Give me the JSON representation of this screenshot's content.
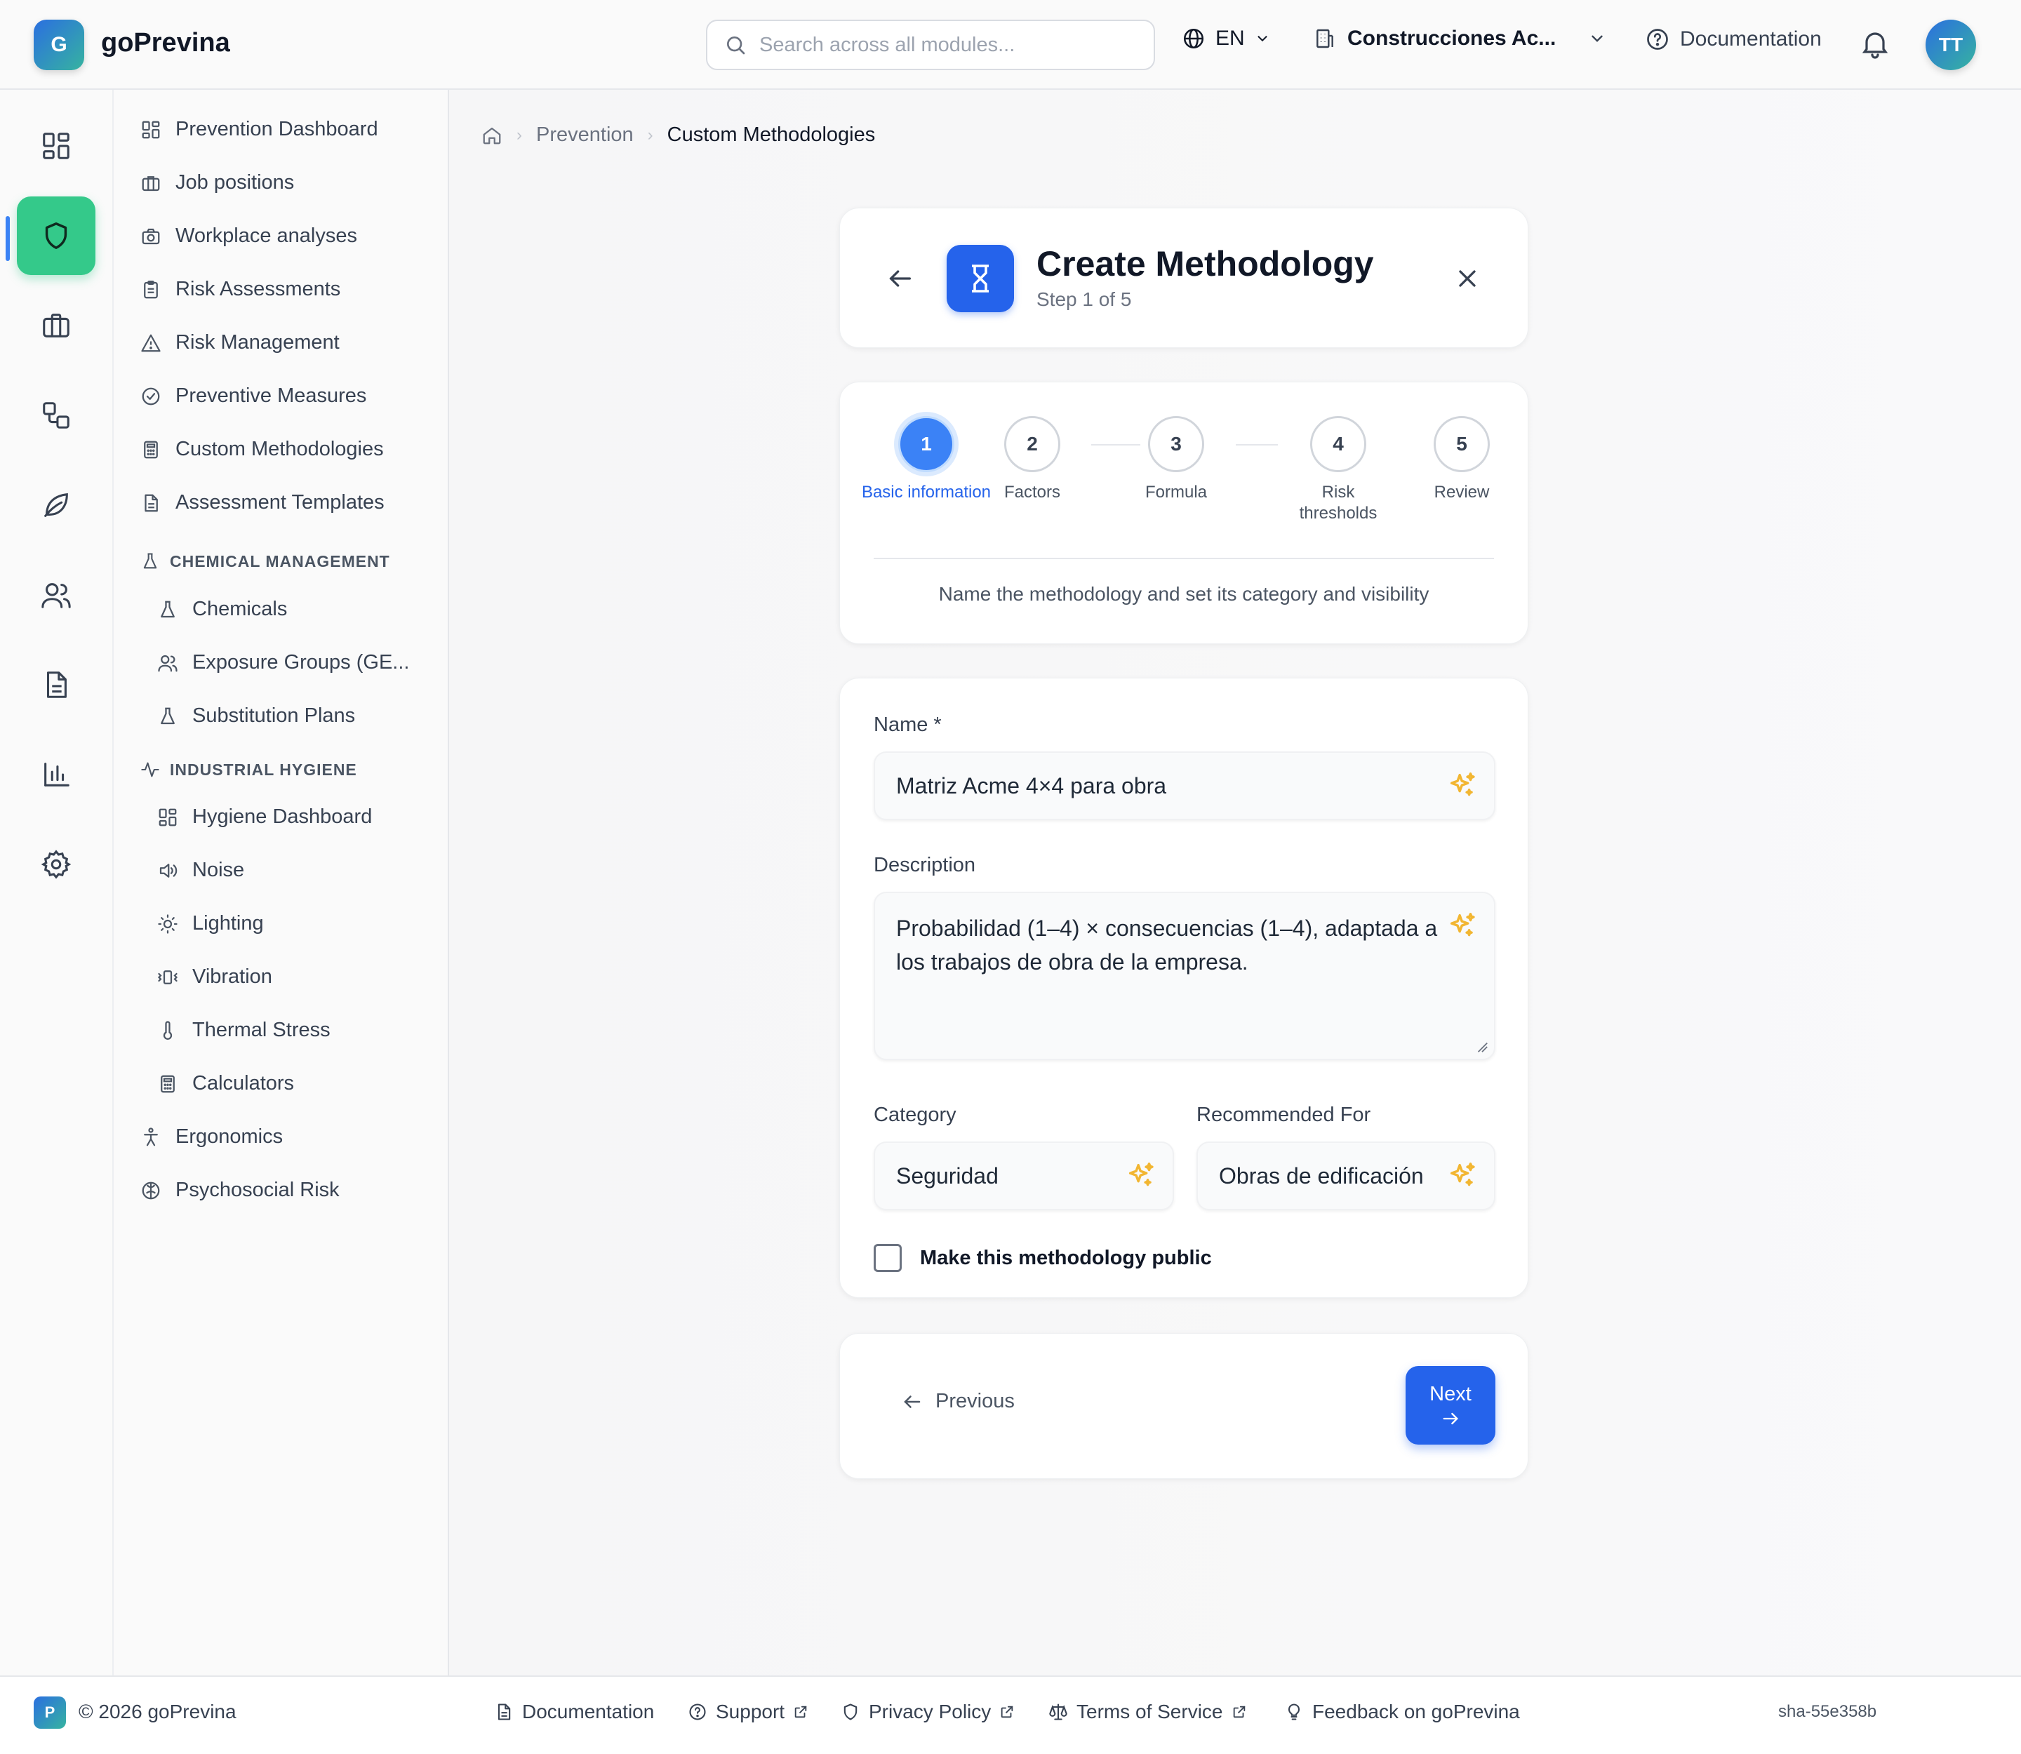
{
  "header": {
    "brand": "goPrevina",
    "logo_letter": "G",
    "search_placeholder": "Search across all modules...",
    "language": "EN",
    "company": "Construcciones Ac...",
    "documentation": "Documentation",
    "avatar_initials": "TT"
  },
  "rail": {
    "items": [
      "dashboard-icon",
      "shield-icon",
      "briefcase-icon",
      "workflow-icon",
      "leaf-icon",
      "users-icon",
      "document-icon",
      "bar-chart-icon",
      "gear-icon"
    ],
    "active_index": 1
  },
  "nav": {
    "items": [
      {
        "label": "Prevention Dashboard",
        "icon": "grid-icon"
      },
      {
        "label": "Job positions",
        "icon": "briefcase-icon"
      },
      {
        "label": "Workplace analyses",
        "icon": "camera-icon"
      },
      {
        "label": "Risk Assessments",
        "icon": "clipboard-icon"
      },
      {
        "label": "Risk Management",
        "icon": "warning-icon"
      },
      {
        "label": "Preventive Measures",
        "icon": "check-circle-icon"
      },
      {
        "label": "Custom Methodologies",
        "icon": "calculator-icon"
      },
      {
        "label": "Assessment Templates",
        "icon": "file-icon"
      }
    ],
    "chemical_section": "CHEMICAL MANAGEMENT",
    "chemical_items": [
      {
        "label": "Chemicals",
        "icon": "flask-icon"
      },
      {
        "label": "Exposure Groups (GE...",
        "icon": "users-icon"
      },
      {
        "label": "Substitution Plans",
        "icon": "flask-icon"
      }
    ],
    "hygiene_section": "INDUSTRIAL HYGIENE",
    "hygiene_items": [
      {
        "label": "Hygiene Dashboard",
        "icon": "grid-icon"
      },
      {
        "label": "Noise",
        "icon": "speaker-icon"
      },
      {
        "label": "Lighting",
        "icon": "sun-icon"
      },
      {
        "label": "Vibration",
        "icon": "vibration-icon"
      },
      {
        "label": "Thermal Stress",
        "icon": "thermometer-icon"
      },
      {
        "label": "Calculators",
        "icon": "calculator-icon"
      }
    ],
    "bottom_items": [
      {
        "label": "Ergonomics",
        "icon": "person-icon"
      },
      {
        "label": "Psychosocial Risk",
        "icon": "brain-icon"
      }
    ]
  },
  "breadcrumb": {
    "parent": "Prevention",
    "current": "Custom Methodologies"
  },
  "wizard": {
    "title": "Create Methodology",
    "step_text": "Step 1 of 5",
    "steps": [
      {
        "number": "1",
        "label": "Basic information"
      },
      {
        "number": "2",
        "label": "Factors"
      },
      {
        "number": "3",
        "label": "Formula"
      },
      {
        "number": "4",
        "label": "Risk thresholds"
      },
      {
        "number": "5",
        "label": "Review"
      }
    ],
    "active_step": 1,
    "step_description": "Name the methodology and set its category and visibility"
  },
  "form": {
    "name_label": "Name *",
    "name_value": "Matriz Acme 4×4 para obra",
    "description_label": "Description",
    "description_value": "Probabilidad (1–4) × consecuencias (1–4), adaptada a los trabajos de obra de la empresa.",
    "category_label": "Category",
    "category_value": "Seguridad",
    "recommended_label": "Recommended For",
    "recommended_value": "Obras de edificación",
    "public_label": "Make this methodology public",
    "public_checked": false
  },
  "buttons": {
    "previous": "Previous",
    "next": "Next"
  },
  "footer": {
    "logo_letter": "P",
    "copyright": "© 2026 goPrevina",
    "documentation": "Documentation",
    "support": "Support",
    "privacy": "Privacy Policy",
    "terms": "Terms of Service",
    "feedback": "Feedback on goPrevina",
    "sha": "sha-55e358b"
  },
  "colors": {
    "primary": "#2563eb",
    "active_green": "#34c98a",
    "sparkle": "#f2b632"
  }
}
